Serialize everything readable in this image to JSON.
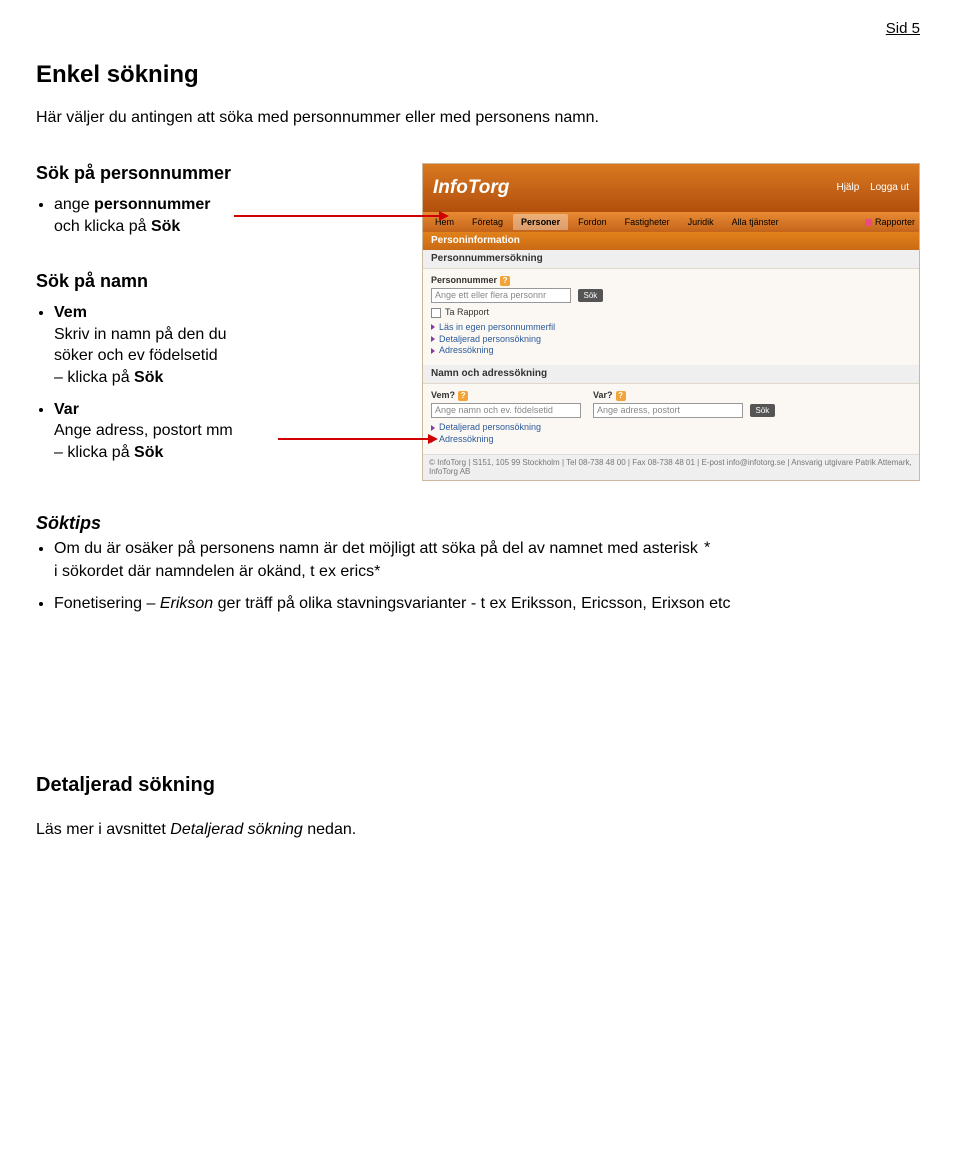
{
  "page_number": "Sid 5",
  "heading_main": "Enkel sökning",
  "intro": "Här väljer du antingen att söka med personnummer eller med personens namn.",
  "sec1_h": "Sök på personnummer",
  "sec1_b1_1": "ange ",
  "sec1_b1_2": "personnummer",
  "sec1_b1_3": "och klicka på ",
  "sec1_b1_4": "Sök",
  "sec2_h": "Sök på namn",
  "sec2_b1_head": "Vem",
  "sec2_b1_l1": "Skriv in namn på den du",
  "sec2_b1_l2": "söker och ev födelsetid",
  "sec2_b1_l3_1": "– klicka på ",
  "sec2_b1_l3_2": "Sök",
  "sec2_b2_head": "Var",
  "sec2_b2_l1": "Ange adress, postort mm",
  "sec2_b2_l2_1": "– klicka på ",
  "sec2_b2_l2_2": "Sök",
  "shot": {
    "logo": "InfoTorg",
    "top_help": "Hjälp",
    "top_logout": "Logga ut",
    "nav": [
      "Hem",
      "Företag",
      "Personer",
      "Fordon",
      "Fastigheter",
      "Juridik",
      "Alla tjänster"
    ],
    "nav_rapporter": "Rapporter",
    "bar_personinfo": "Personinformation",
    "bar_personsok": "Personnummersökning",
    "lbl_personnummer": "Personnummer",
    "ph_person": "Ange ett eller flera personnr",
    "btn_sok": "Sök",
    "ta_rapport": "Ta Rapport",
    "links1": [
      "Läs in egen personnummerfil",
      "Detaljerad personsökning",
      "Adressökning"
    ],
    "bar_namn": "Namn och adressökning",
    "lbl_vem": "Vem?",
    "lbl_var": "Var?",
    "ph_vem": "Ange namn och ev. födelsetid",
    "ph_var": "Ange adress, postort",
    "links2": [
      "Detaljerad personsökning",
      "Adressökning"
    ],
    "footer": "© InfoTorg | S151, 105 99 Stockholm | Tel 08-738 48 00 | Fax 08-738 48 01 | E-post info@infotorg.se | Ansvarig utgivare Patrik Attemark, InfoTorg AB"
  },
  "soktips_h": "Söktips",
  "tip1_a": "Om du är osäker på personens namn är det möjligt att söka på del av namnet med asterisk ",
  "tip1_ast": "*",
  "tip1_b": "i sökordet där namndelen är okänd, t ex erics*",
  "tip2_a": "Fonetisering – ",
  "tip2_it": "Erikson",
  "tip2_b": " ger träff på olika stavningsvarianter - t ex Eriksson, Ericsson, Erixson etc",
  "det_h": "Detaljerad sökning",
  "det_line_a": "Läs mer i avsnittet ",
  "det_line_it": "Detaljerad sökning",
  "det_line_b": " nedan."
}
